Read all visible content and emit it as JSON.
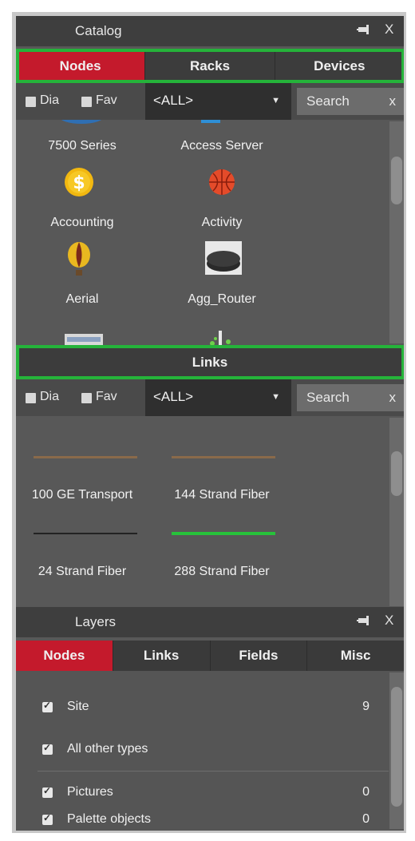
{
  "catalog": {
    "title": "Catalog",
    "pin_icon": "pin-icon",
    "close_label": "X",
    "tabs": [
      {
        "label": "Nodes",
        "active": true
      },
      {
        "label": "Racks",
        "active": false
      },
      {
        "label": "Devices",
        "active": false
      }
    ],
    "filter": {
      "dia_label": "Dia",
      "fav_label": "Fav",
      "select_value": "<ALL>",
      "search_placeholder": "Search",
      "clear_label": "x"
    },
    "items": [
      {
        "label": "7500 Series",
        "icon": "7500-series-icon"
      },
      {
        "label": "Access Server",
        "icon": "access-server-icon"
      },
      {
        "label": "Accounting",
        "icon": "dollar-coin-icon"
      },
      {
        "label": "Activity",
        "icon": "basketball-icon"
      },
      {
        "label": "Aerial",
        "icon": "hot-air-balloon-icon"
      },
      {
        "label": "Agg_Router",
        "icon": "router-icon"
      }
    ]
  },
  "links": {
    "title": "Links",
    "filter": {
      "dia_label": "Dia",
      "fav_label": "Fav",
      "select_value": "<ALL>",
      "search_placeholder": "Search",
      "clear_label": "x"
    },
    "items": [
      {
        "label": "100 GE Transport",
        "color": "#8a6a4a"
      },
      {
        "label": "144 Strand Fiber",
        "color": "#8a6a4a"
      },
      {
        "label": "24 Strand Fiber",
        "color": "#222222"
      },
      {
        "label": "288 Strand Fiber",
        "color": "#27c23a"
      }
    ]
  },
  "layers": {
    "title": "Layers",
    "pin_icon": "pin-icon",
    "close_label": "X",
    "tabs": [
      {
        "label": "Nodes",
        "active": true
      },
      {
        "label": "Links",
        "active": false
      },
      {
        "label": "Fields",
        "active": false
      },
      {
        "label": "Misc",
        "active": false
      }
    ],
    "rows": [
      {
        "label": "Site",
        "count": "9",
        "checked": true
      },
      {
        "label": "All other types",
        "count": "",
        "checked": true
      },
      {
        "label": "Pictures",
        "count": "0",
        "checked": true
      },
      {
        "label": "Palette objects",
        "count": "0",
        "checked": true
      }
    ]
  },
  "colors": {
    "accent_red": "#c41a2c",
    "highlight_green": "#25b33a",
    "panel_bg": "#585858"
  }
}
